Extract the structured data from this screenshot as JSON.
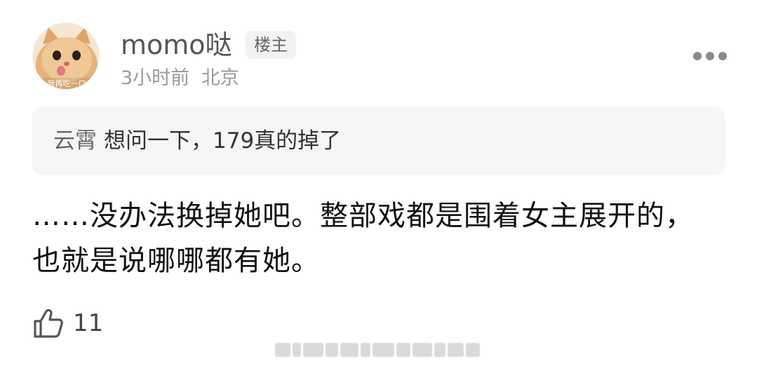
{
  "post": {
    "username": "momo哒",
    "op_badge": "楼主",
    "time": "3小时前",
    "location": "北京",
    "quote": {
      "author": "云霄",
      "text": "想问一下，179真的掉了"
    },
    "comment": "……没办法换掉她吧。整部戏都是围着女主展开的，也就是说哪哪都有她。",
    "likes": "11",
    "avatar_caption": "我再吃一口"
  },
  "icons": {
    "more": "more-dots-icon",
    "like": "thumbs-up-icon",
    "avatar": "cat-avatar-image"
  },
  "colors": {
    "text_primary": "#111111",
    "text_secondary": "#9a9a9a",
    "quote_bg": "#f6f6f6",
    "badge_bg": "#f2f2f2"
  }
}
